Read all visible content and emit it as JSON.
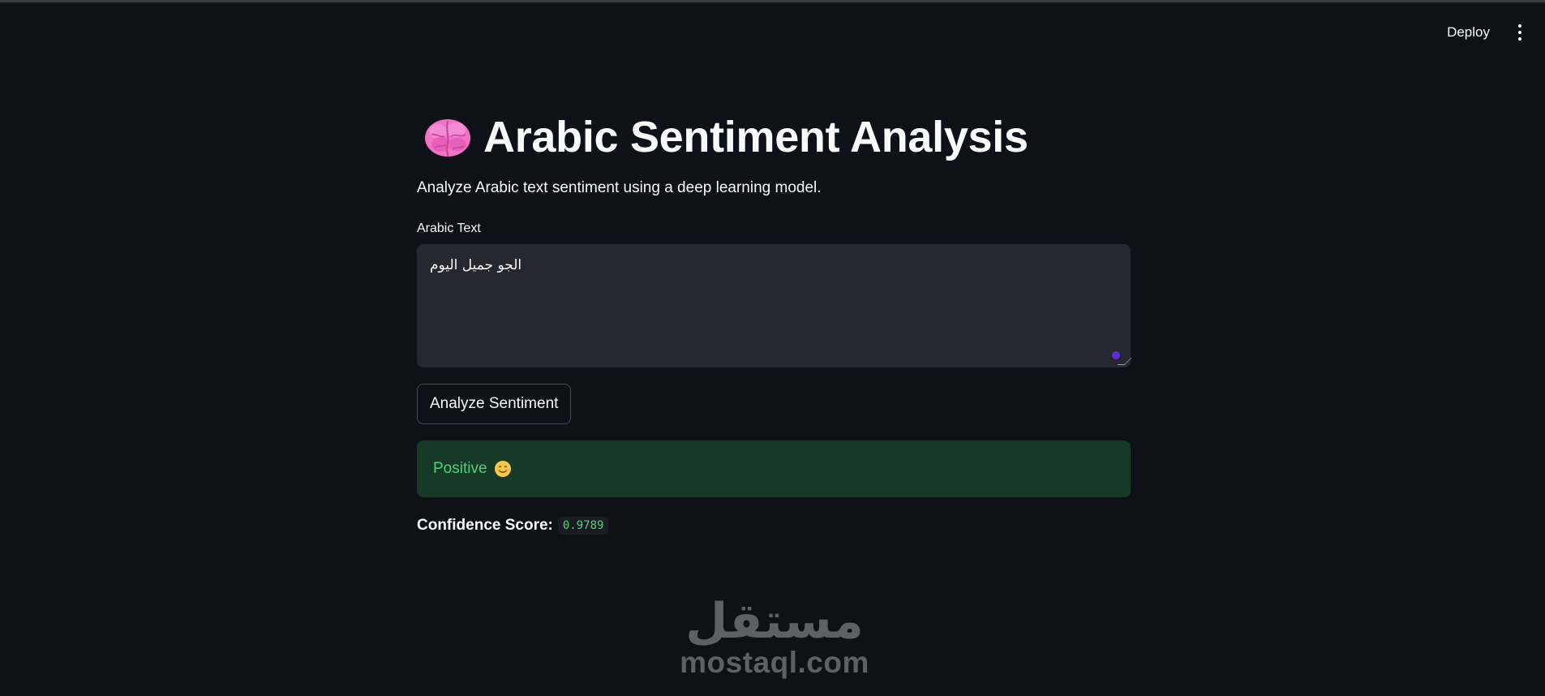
{
  "header": {
    "deploy_label": "Deploy",
    "menu_icon": "vertical-dots-icon"
  },
  "main": {
    "title": "Arabic Sentiment Analysis",
    "title_icon": "brain-icon",
    "subtitle": "Analyze Arabic text sentiment using a deep learning model.",
    "input_label": "Arabic Text",
    "input_value": "الجو جميل اليوم",
    "analyze_button_label": "Analyze Sentiment",
    "result": {
      "label": "Positive",
      "icon": "smiling-face-icon",
      "status_color": "#4fd17a",
      "background_color": "#173928"
    },
    "confidence_label": "Confidence Score:",
    "confidence_value": "0.9789"
  },
  "watermark": {
    "arabic": "مستقل",
    "latin": "mostaql.com"
  },
  "colors": {
    "background": "#0e1117",
    "input_background": "#262730",
    "accent": "#5b2ddb"
  }
}
